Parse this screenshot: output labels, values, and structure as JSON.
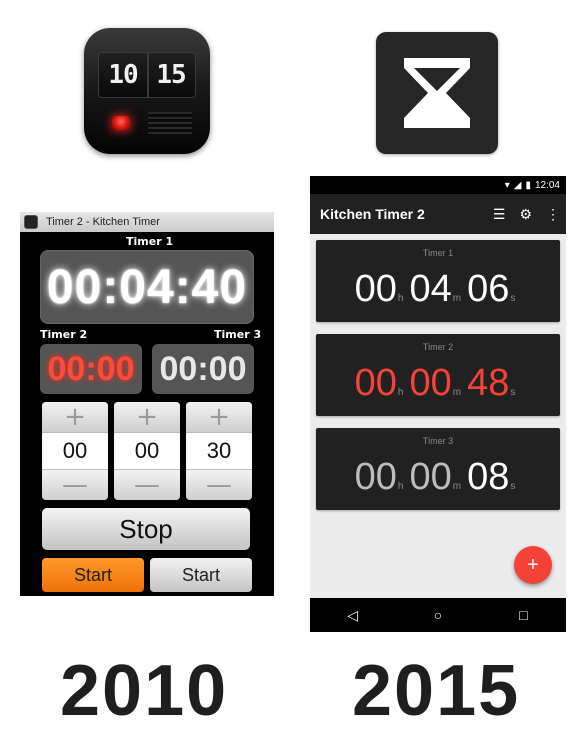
{
  "icons": {
    "old_flip_left": "10",
    "old_flip_right": "15"
  },
  "old_app": {
    "window_title": "Timer 2 - Kitchen Timer",
    "timer1_label": "Timer 1",
    "timer1_value": "00:04:40",
    "timer2_label": "Timer 2",
    "timer2_value": "00:00",
    "timer3_label": "Timer 3",
    "timer3_value": "00:00",
    "steppers": [
      {
        "plus": "+",
        "value": "00",
        "minus": "—"
      },
      {
        "plus": "+",
        "value": "00",
        "minus": "—"
      },
      {
        "plus": "+",
        "value": "30",
        "minus": "—"
      }
    ],
    "stop_label": "Stop",
    "start_left_label": "Start",
    "start_right_label": "Start",
    "accent_color": "#f0700a",
    "timer2_color": "#ff4a3a"
  },
  "new_app": {
    "status_time": "12:04",
    "title": "Kitchen Timer 2",
    "timers": [
      {
        "label": "Timer 1",
        "h": "00",
        "m": "04",
        "s": "06",
        "h_unit": "h",
        "m_unit": "m",
        "s_unit": "s"
      },
      {
        "label": "Timer 2",
        "h": "00",
        "m": "00",
        "s": "48",
        "h_unit": "h",
        "m_unit": "m",
        "s_unit": "s"
      },
      {
        "label": "Timer 3",
        "h": "00",
        "m": "00",
        "s": "08",
        "h_unit": "h",
        "m_unit": "m",
        "s_unit": "s"
      }
    ],
    "fab_label": "+",
    "accent_color": "#f44336",
    "nav": {
      "back": "◁",
      "home": "○",
      "recents": "□"
    }
  },
  "years": {
    "left": "2010",
    "right": "2015"
  }
}
